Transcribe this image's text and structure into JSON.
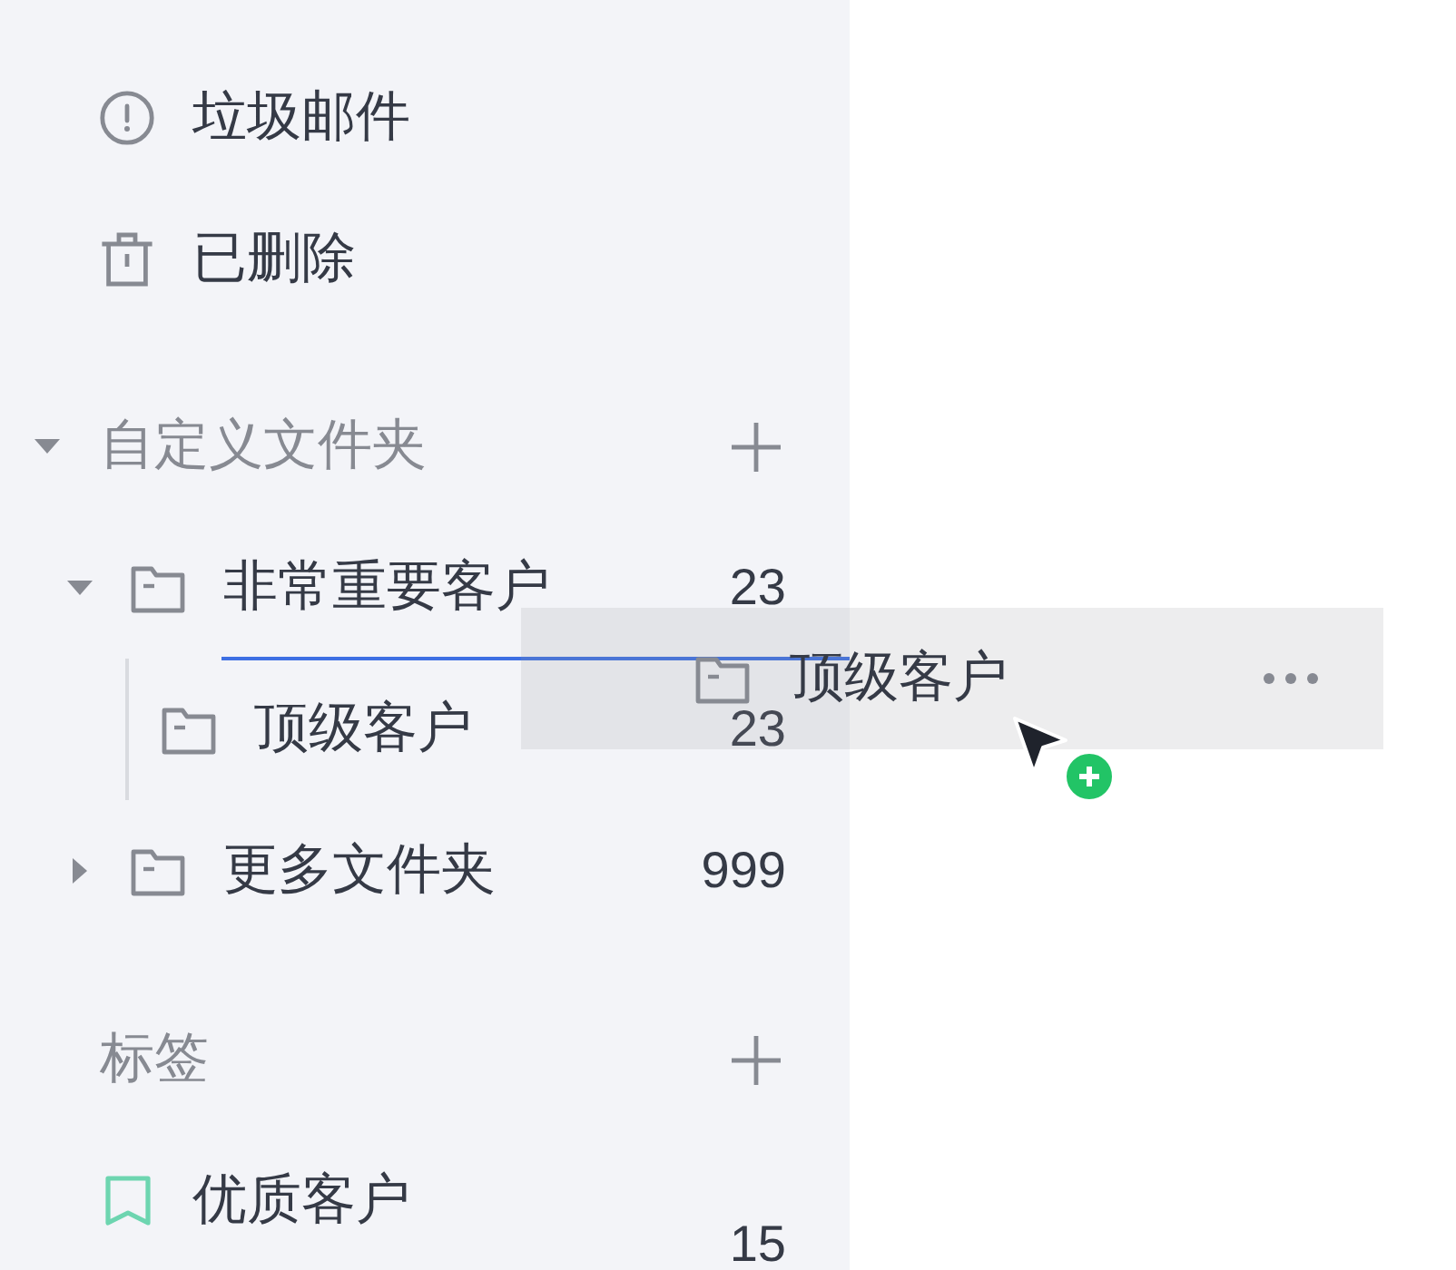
{
  "sidebar": {
    "mail_folders": [
      {
        "kind": "spam",
        "label": "垃圾邮件"
      },
      {
        "kind": "trash",
        "label": "已删除"
      }
    ],
    "custom_folders": {
      "title": "自定义文件夹",
      "expanded": true,
      "items": [
        {
          "label": "非常重要客户",
          "count": "23",
          "expanded": true,
          "drop_target": true,
          "children": [
            {
              "label": "顶级客户",
              "count": "23",
              "drop_target": false
            }
          ]
        },
        {
          "label": "更多文件夹",
          "count": "999",
          "expanded": false,
          "drop_target": false
        }
      ]
    },
    "tags": {
      "title": "标签",
      "items": [
        {
          "label": "优质客户",
          "color": "#6dd5b0",
          "count": "15"
        }
      ]
    }
  },
  "drag_preview": {
    "label": "顶级客户"
  }
}
